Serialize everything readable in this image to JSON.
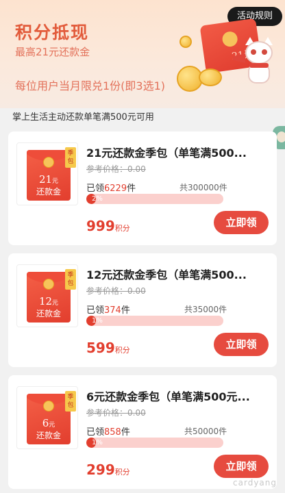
{
  "hero": {
    "title": "积分抵现",
    "subtitle": "最高21元还款金",
    "limit": "每位用户当月限兑1份(即3选1)",
    "rules_button": "活动规则",
    "decor_amount": "21元"
  },
  "notice": "掌上生活主动还款单笔满500元可用",
  "cards": [
    {
      "title": "21元还款金季包（单笔满500...",
      "ref_price": "参考价格：0.00",
      "claimed_prefix": "已领",
      "claimed_count": "6229",
      "claimed_suffix": "件",
      "total": "共300000件",
      "progress_label": "2%",
      "progress": 0.02,
      "points": "999",
      "points_unit": "积分",
      "button": "立即领",
      "env_amount": "21",
      "env_unit": "元",
      "env_label": "还款金",
      "tag": "季包"
    },
    {
      "title": "12元还款金季包（单笔满500...",
      "ref_price": "参考价格：0.00",
      "claimed_prefix": "已领",
      "claimed_count": "374",
      "claimed_suffix": "件",
      "total": "共35000件",
      "progress_label": "1%",
      "progress": 0.01,
      "points": "599",
      "points_unit": "积分",
      "button": "立即领",
      "env_amount": "12",
      "env_unit": "元",
      "env_label": "还款金",
      "tag": "季包"
    },
    {
      "title": "6元还款金季包（单笔满500元...",
      "ref_price": "参考价格：0.00",
      "claimed_prefix": "已领",
      "claimed_count": "858",
      "claimed_suffix": "件",
      "total": "共50000件",
      "progress_label": "1%",
      "progress": 0.01,
      "points": "299",
      "points_unit": "积分",
      "button": "立即领",
      "env_amount": "6",
      "env_unit": "元",
      "env_label": "还款金",
      "tag": "季包"
    }
  ],
  "watermark": "cardyang",
  "colors": {
    "accent": "#e23e2e",
    "button": "#e64b3f",
    "hero_text": "#e25b3b",
    "bar_track": "#fbd0cd"
  }
}
